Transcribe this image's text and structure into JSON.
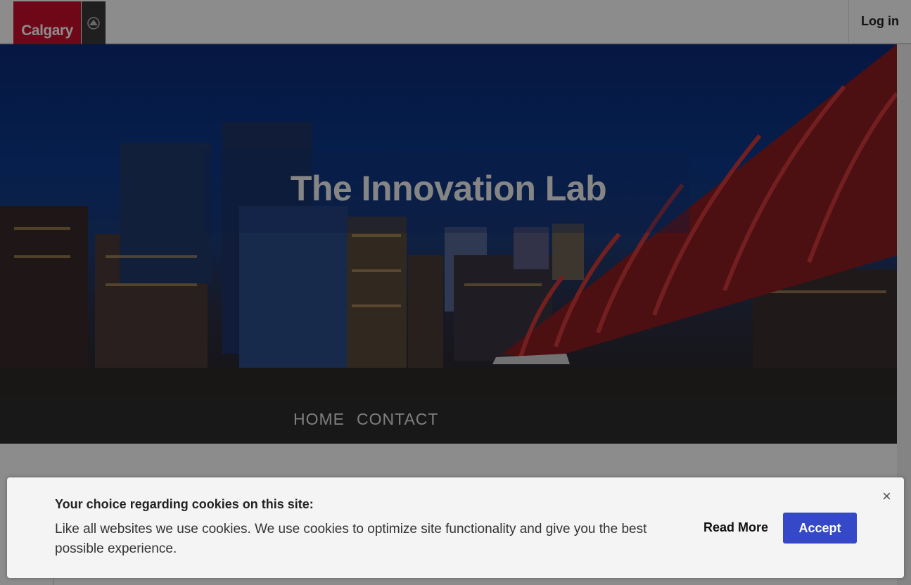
{
  "header": {
    "logo_text": "Calgary",
    "login_label": "Log in"
  },
  "hero": {
    "title": "The Innovation Lab"
  },
  "nav": {
    "items": [
      {
        "label": "HOME"
      },
      {
        "label": "CONTACT"
      }
    ]
  },
  "cookie_banner": {
    "title": "Your choice regarding cookies on this site:",
    "text": "Like all websites we use cookies. We use cookies to optimize site functionality and give you the best possible experience.",
    "read_more_label": "Read More",
    "accept_label": "Accept",
    "close_symbol": "×",
    "accept_color": "#3548c8"
  },
  "brand": {
    "red": "#c8102e"
  }
}
